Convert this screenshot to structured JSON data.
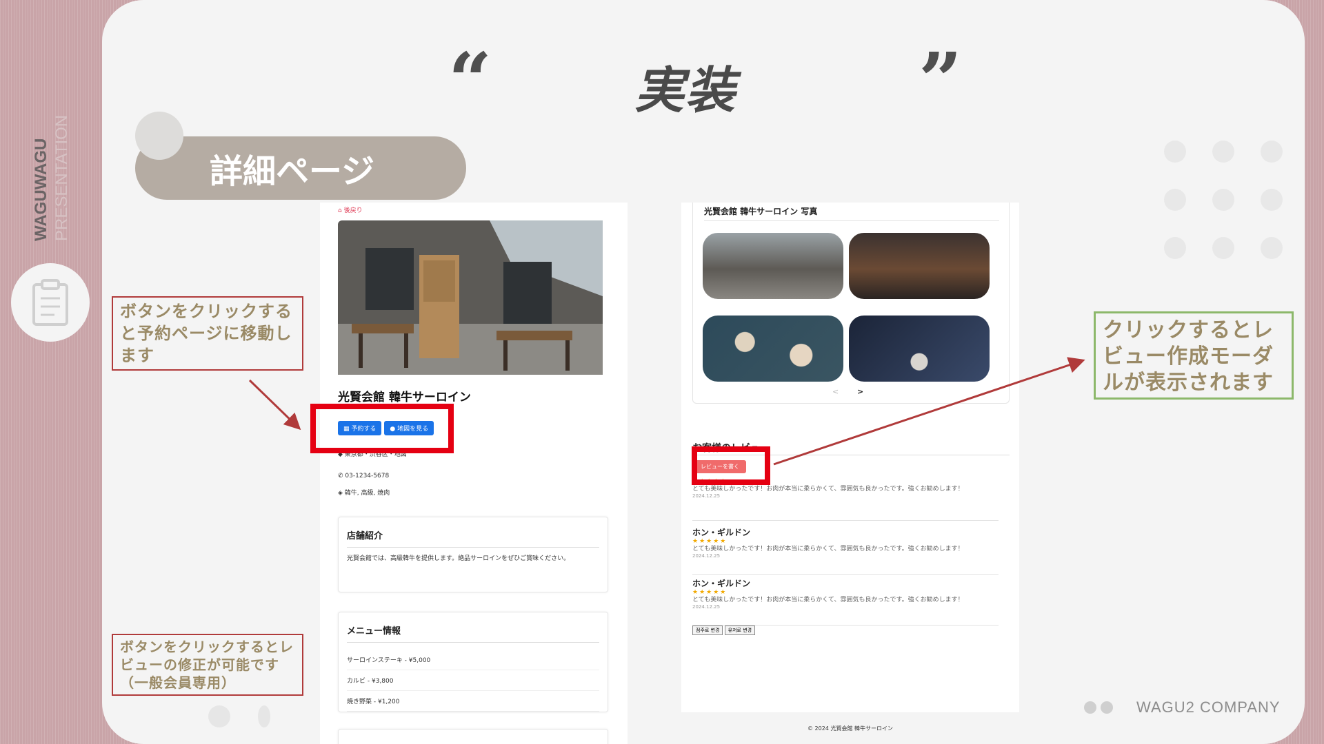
{
  "sidebar": {
    "brand_line1": "WAGUWAGU",
    "brand_line2": "PRESENTATION",
    "icon": "clipboard-icon"
  },
  "header": {
    "title": "実装",
    "open_quote": "“",
    "close_quote": "”"
  },
  "section_pill": {
    "label": "詳細ページ"
  },
  "notes": {
    "reserve": "ボタンをクリックすると予約ページに移動します",
    "review_edit": "ボタンをクリックするとレビューの修正が可能です（一般会員専用）",
    "review_modal": "クリックするとレビュー作成モーダルが表示されます"
  },
  "left_shot": {
    "back_link": "後戻り",
    "restaurant_name": "光賢会館 韓牛サーロイン",
    "buttons": {
      "reserve": "予約する",
      "map": "地図を見る"
    },
    "address": "東京都・渋谷区・地図",
    "phone": "03-1234-5678",
    "tags": "韓牛, 高級, 焼肉",
    "intro": {
      "heading": "店舗紹介",
      "text": "光賢会館では、高級韓牛を提供します。絶品サーロインをぜひご賞味ください。"
    },
    "menu": {
      "heading": "メニュー情報",
      "items": [
        "サーロインステーキ - ¥5,000",
        "カルビ - ¥3,800",
        "焼き野菜 - ¥1,200"
      ]
    }
  },
  "right_shot": {
    "gallery_title": "光賢会館 韓牛サーロイン 写真",
    "carousel": {
      "prev": "<",
      "next": ">"
    },
    "reviews_heading": "お客様のレビュー",
    "write_review_button": "レビューを書く",
    "reviews": [
      {
        "name": "",
        "stars": "★★★★★",
        "body": "とても美味しかったです！お肉が本当に柔らかくて、雰囲気も良かったです。強くお勧めします！",
        "date": "2024.12.25"
      },
      {
        "name": "ホン・ギルドン",
        "stars": "★★★★★",
        "body": "とても美味しかったです！お肉が本当に柔らかくて、雰囲気も良かったです。強くお勧めします！",
        "date": "2024.12.25"
      },
      {
        "name": "ホン・ギルドン",
        "stars": "★★★★★",
        "body": "とても美味しかったです！お肉が本当に柔らかくて、雰囲気も良かったです。強くお勧めします！",
        "date": "2024.12.25"
      }
    ],
    "edit_buttons": [
      "점주로 변경",
      "유저로 변경"
    ],
    "footer": "© 2024 光賢会館 韓牛サーロイン"
  },
  "company": "WAGU2 COMPANY"
}
